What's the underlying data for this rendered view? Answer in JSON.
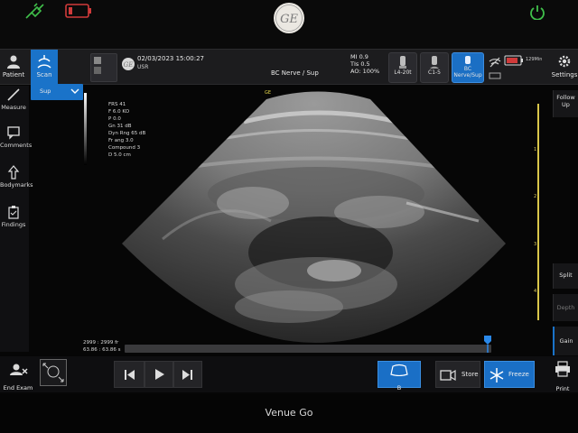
{
  "brand": {
    "bezel_label": "Venue Go"
  },
  "topbar": {
    "patient_label": "Patient",
    "scan_label": "Scan",
    "datetime": "02/03/2023 15:00:27",
    "user": "USR",
    "preset": "BC  Nerve / Sup",
    "mi": "MI 0.9",
    "tis": "TIs 0.5",
    "ao": "AO: 100%",
    "probes": [
      {
        "name": "L4-20t"
      },
      {
        "name": "C1-5"
      },
      {
        "name": "BC",
        "sub": "Nerve/Sup"
      }
    ],
    "battery_time": "129Min",
    "settings_label": "Settings"
  },
  "left_tools": {
    "sup_label": "Sup",
    "measure_label": "Measure",
    "comments_label": "Comments",
    "bodymarks_label": "Bodymarks",
    "findings_label": "Findings"
  },
  "overlay": {
    "lines": [
      "FRS 41",
      "F 6.0 KO",
      "P 0.0",
      "Gn 31 dB",
      "Dyn Rng 65 dB",
      "Fr ang 3.0",
      "Compound 3",
      "D 5.0 cm"
    ],
    "probe_mark": "GE"
  },
  "depth_ticks": [
    "1",
    "2",
    "3",
    "4"
  ],
  "right_panel": {
    "follow_up_label": "Follow Up",
    "split_label": "Split",
    "depth_label": "Depth",
    "gain_label": "Gain"
  },
  "cine": {
    "frames": "2999 : 2999 fr",
    "time": "63.86 : 63.86 s",
    "position_pct": 99
  },
  "bottom": {
    "end_exam_label": "End Exam",
    "mode_label": "B",
    "store_label": "Store",
    "freeze_label": "Freeze",
    "print_label": "Print"
  },
  "colors": {
    "accent": "#1a73c9",
    "battery": "#d03a3a",
    "power": "#3fbf4a",
    "plug": "#3fbf4a"
  }
}
